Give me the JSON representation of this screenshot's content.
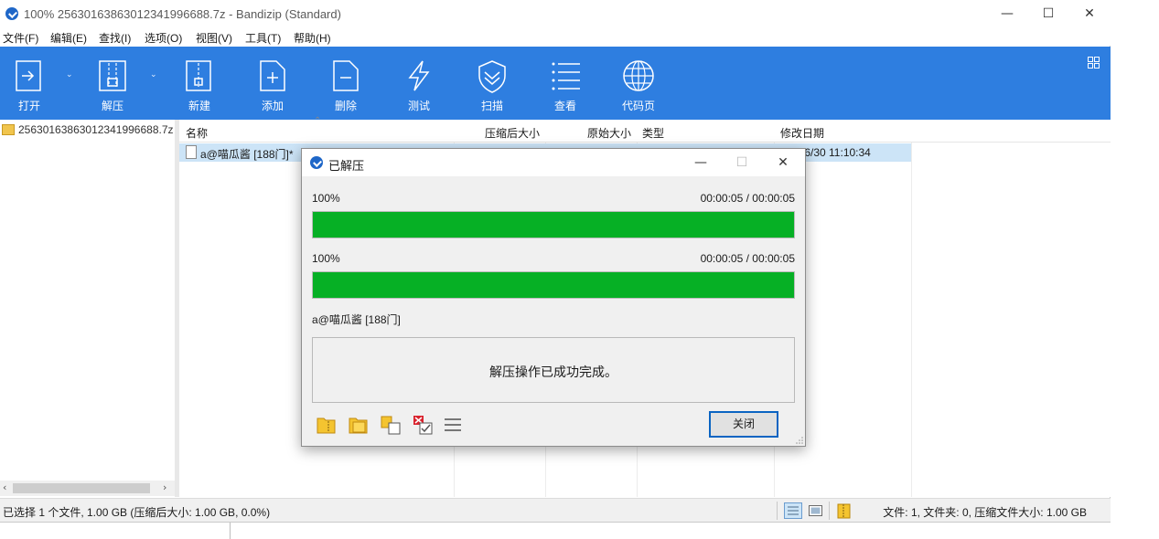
{
  "window": {
    "title": "100% 2563016386301234199668​8.7z - Bandizip (Standard)",
    "minimize": "—",
    "maximize": "☐",
    "close": "✕"
  },
  "menu": {
    "items": [
      "文件(F)",
      "编辑(E)",
      "查找(I)",
      "选项(O)",
      "视图(V)",
      "工具(T)",
      "帮助(H)"
    ]
  },
  "toolbar": {
    "buttons": [
      {
        "label": "打开",
        "icon": "open-archive-icon"
      },
      {
        "label": "解压",
        "icon": "extract-icon"
      },
      {
        "label": "新建",
        "icon": "new-archive-icon"
      },
      {
        "label": "添加",
        "icon": "add-file-icon"
      },
      {
        "label": "删除",
        "icon": "delete-file-icon"
      },
      {
        "label": "测试",
        "icon": "test-lightning-icon"
      },
      {
        "label": "扫描",
        "icon": "scan-shield-icon"
      },
      {
        "label": "查看",
        "icon": "view-list-icon"
      },
      {
        "label": "代码页",
        "icon": "codepage-globe-icon"
      }
    ],
    "dropdown_caret": "⌄",
    "color": "#2e7ee0"
  },
  "tree": {
    "root_label": "2563016386301234199668​8.7z",
    "scroll_left": "‹",
    "scroll_right": "›"
  },
  "list": {
    "columns": {
      "name": "名称",
      "packed": "压缩后大小",
      "size": "原始大小",
      "type": "类型",
      "modified": "修改日期"
    },
    "sort_indicator": "⌃",
    "rows": [
      {
        "name": "a@喵瓜酱 [188门]*",
        "modified": "/6/30 11:10:34"
      }
    ]
  },
  "status": {
    "left": "已选择 1 个文件, 1.00 GB (压缩后大小: 1.00 GB, 0.0%)",
    "right": "文件: 1, 文件夹: 0, 压缩文件大小: 1.00 GB"
  },
  "dialog": {
    "title": "已解压",
    "minimize": "—",
    "maximize": "☐",
    "close": "✕",
    "progress1": {
      "percent_text": "100%",
      "time": "00:00:05 / 00:00:05",
      "fraction": 1.0
    },
    "progress2": {
      "percent_text": "100%",
      "time": "00:00:05 / 00:00:05",
      "fraction": 1.0
    },
    "current_file": "a@喵瓜酱 [188门]",
    "message": "解压操作已成功完成。",
    "close_button": "关闭",
    "progress_color": "#06b025"
  }
}
